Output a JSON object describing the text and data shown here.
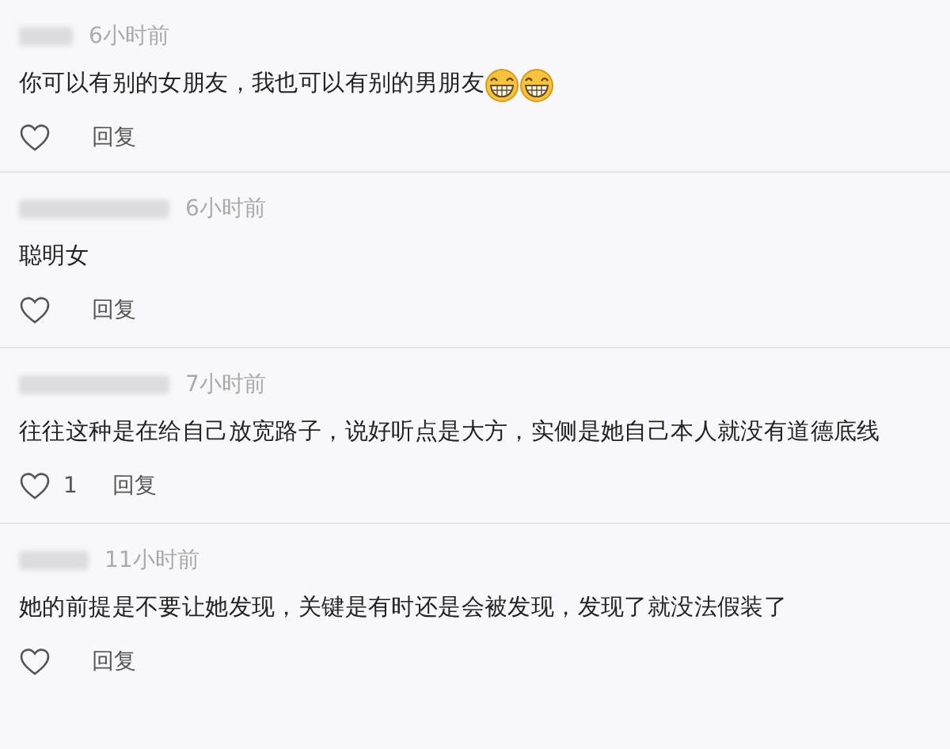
{
  "comments": [
    {
      "time": "6小时前",
      "text": "你可以有别的女朋友，我也可以有别的男朋友",
      "emojis": [
        {
          "kind": "grin"
        },
        {
          "kind": "grin"
        }
      ],
      "reply": "回复"
    },
    {
      "time": "6小时前",
      "text": "聪明女",
      "reply": "回复"
    },
    {
      "time": "7小时前",
      "text": "往往这种是在给自己放宽路子，说好听点是大方，实侧是她自己本人就没有道德底线",
      "likes": "1",
      "reply": "回复"
    },
    {
      "time": "11小时前",
      "text": "她的前提是不要让她发现，关键是有时还是会被发现，发现了就没法假装了",
      "reply": "回复"
    }
  ]
}
